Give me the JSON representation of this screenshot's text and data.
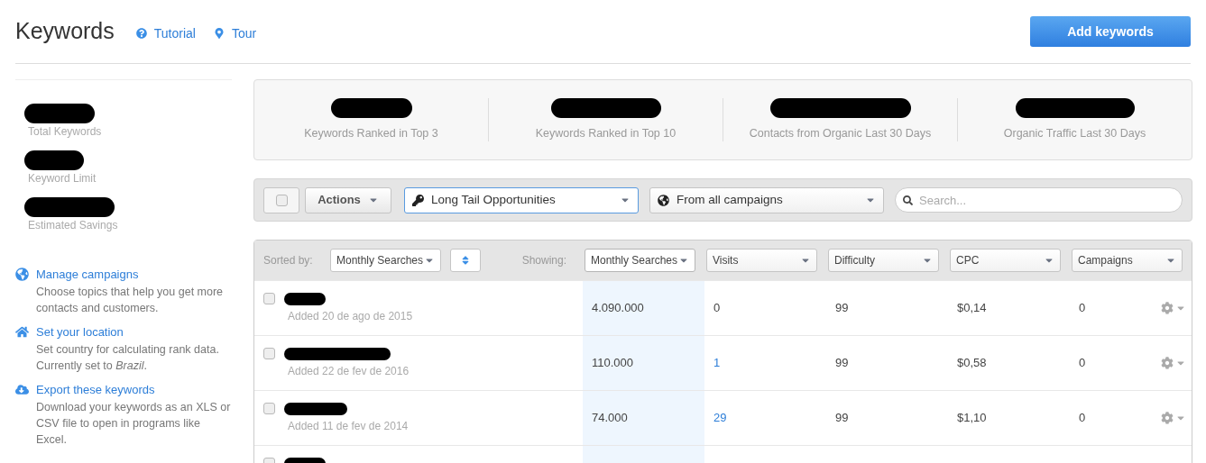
{
  "header": {
    "title": "Keywords",
    "links": [
      {
        "kind": "help",
        "label": "Tutorial"
      },
      {
        "kind": "pin",
        "label": "Tour"
      }
    ],
    "add_button": "Add keywords"
  },
  "sidebar": {
    "stats": [
      {
        "label": "Total Keywords"
      },
      {
        "label": "Keyword Limit"
      },
      {
        "label": "Estimated Savings"
      }
    ],
    "actions": [
      {
        "kind": "globe",
        "title": "Manage campaigns",
        "text": "Choose topics that help you get more contacts and customers."
      },
      {
        "kind": "home",
        "title": "Set your location",
        "text": "Set country for calculating rank data. Currently set to *Brazil*."
      },
      {
        "kind": "cloud",
        "title": "Export these keywords",
        "text": "Download your keywords as an XLS or CSV file to open in programs like Excel."
      }
    ]
  },
  "summary": [
    {
      "label": "Keywords Ranked in Top 3"
    },
    {
      "label": "Keywords Ranked in Top 10"
    },
    {
      "label": "Contacts from Organic Last 30 Days"
    },
    {
      "label": "Organic Traffic Last 30 Days"
    }
  ],
  "toolbar": {
    "select_all": {
      "checked": false
    },
    "actions": "Actions",
    "filter": "Long Tail Opportunities",
    "campaign": "From all campaigns",
    "search": {
      "placeholder": "Search..."
    }
  },
  "table": {
    "sorted_by_label": "Sorted by:",
    "sorted_by": "Monthly Searches",
    "showing_label": "Showing:",
    "columns": [
      {
        "label": "Monthly Searches",
        "selected": true
      },
      {
        "label": "Visits",
        "selected": false
      },
      {
        "label": "Difficulty",
        "selected": false
      },
      {
        "label": "CPC",
        "selected": false
      },
      {
        "label": "Campaigns",
        "selected": false
      }
    ],
    "rows": [
      {
        "checked": false,
        "added": "Added 20 de ago de 2015",
        "cells": [
          "4.090.000",
          "0",
          "99",
          "$0,14",
          "0"
        ],
        "visits_link": false
      },
      {
        "checked": false,
        "added": "Added 22 de fev de 2016",
        "cells": [
          "110.000",
          "1",
          "99",
          "$0,58",
          "0"
        ],
        "visits_link": true
      },
      {
        "checked": false,
        "added": "Added 11 de fev de 2014",
        "cells": [
          "74.000",
          "29",
          "99",
          "$1,10",
          "0"
        ],
        "visits_link": true
      },
      {
        "checked": false,
        "cells": []
      }
    ]
  }
}
